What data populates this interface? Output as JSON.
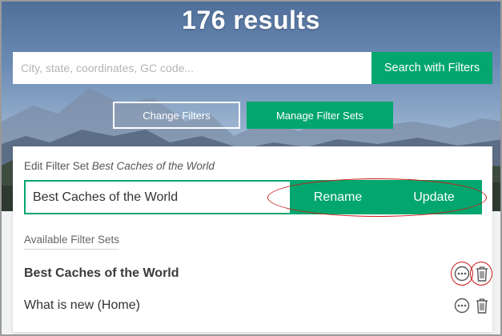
{
  "header": {
    "results_title": "176 results"
  },
  "search": {
    "placeholder": "City, state, coordinates, GC code...",
    "value": "",
    "button_label": "Search with Filters"
  },
  "filters": {
    "change_label": "Change Filters",
    "manage_label": "Manage Filter Sets"
  },
  "edit_panel": {
    "label_prefix": "Edit Filter Set",
    "label_set_name": "Best Caches of the World",
    "name_value": "Best Caches of the World",
    "rename_label": "Rename",
    "update_label": "Update"
  },
  "available": {
    "heading": "Available Filter Sets",
    "items": [
      {
        "name": "Best Caches of the World",
        "active": true,
        "more_icon": "ellipsis-circle-icon",
        "delete_icon": "trash-icon"
      },
      {
        "name": "What is new (Home)",
        "active": false,
        "more_icon": "ellipsis-circle-icon",
        "delete_icon": "trash-icon"
      }
    ]
  },
  "colors": {
    "accent_green": "#02a66e",
    "annotation_red": "#cc1b1b"
  }
}
